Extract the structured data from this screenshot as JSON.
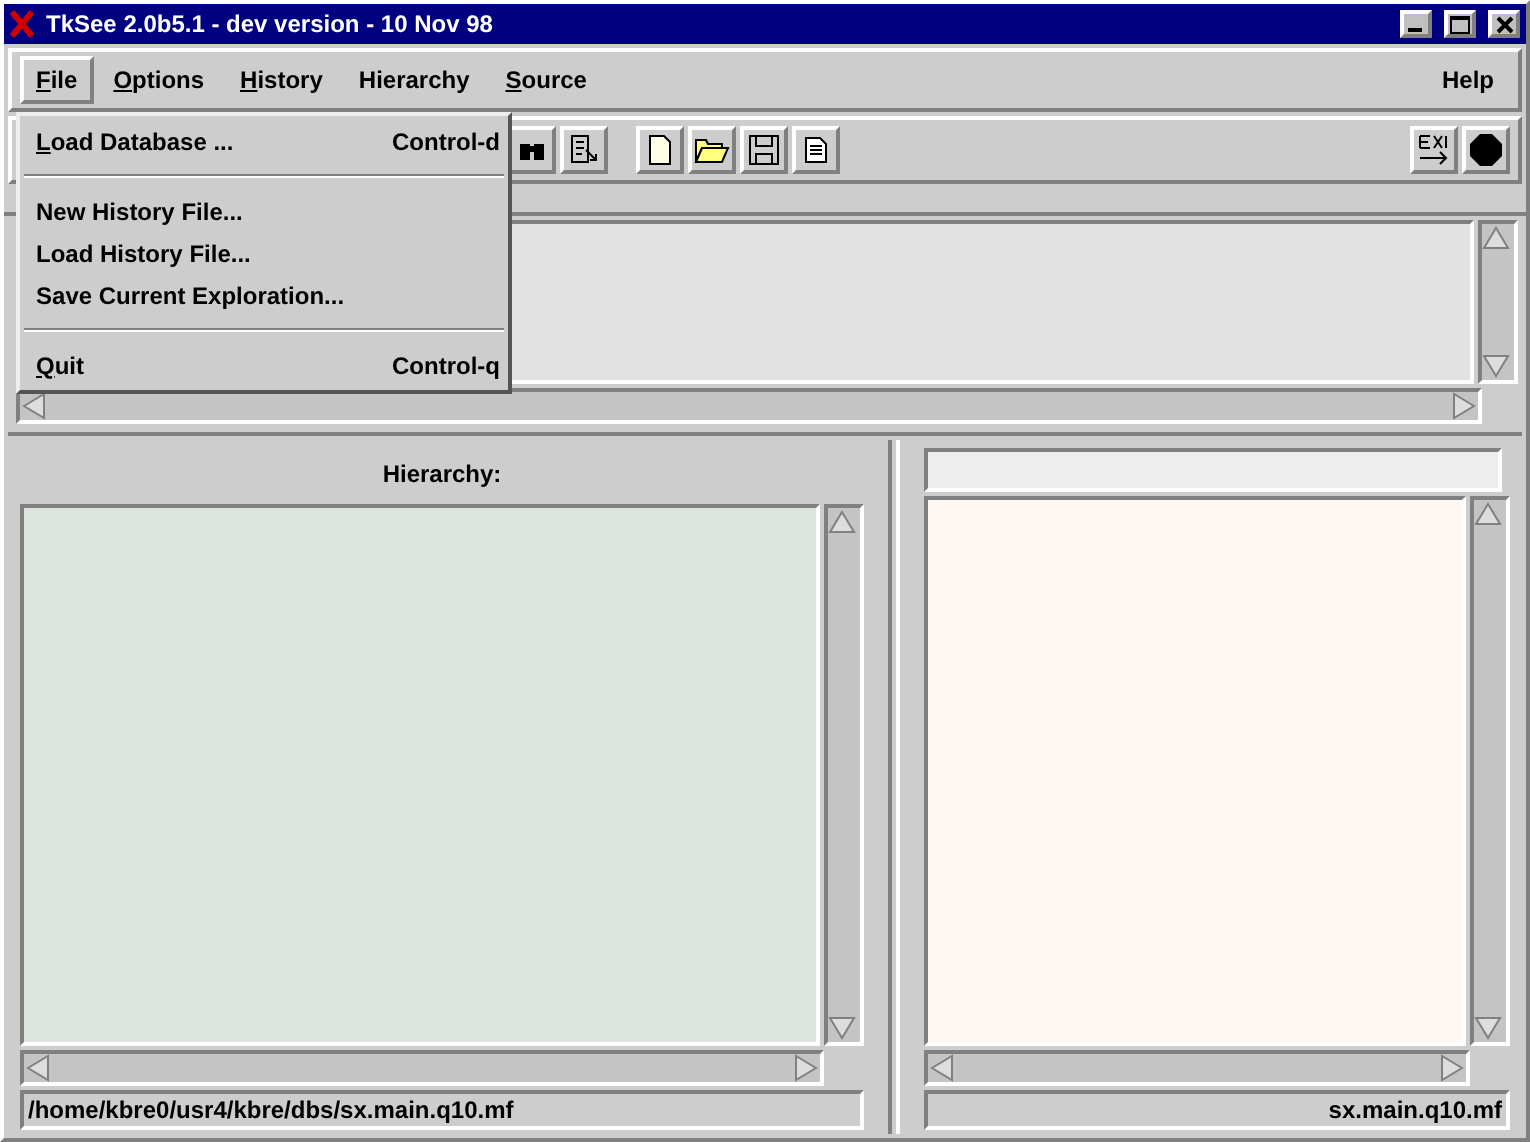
{
  "window": {
    "title": "TkSee 2.0b5.1 - dev version - 10 Nov 98"
  },
  "menubar": [
    {
      "label": "File",
      "underline_first": true,
      "selected": true
    },
    {
      "label": "Options",
      "underline_first": true,
      "selected": false
    },
    {
      "label": "History",
      "underline_first": true,
      "selected": false
    },
    {
      "label": "Hierarchy",
      "underline_first": false,
      "selected": false
    },
    {
      "label": "Source",
      "underline_first": true,
      "selected": false
    }
  ],
  "help": {
    "label": "Help"
  },
  "file_menu": [
    {
      "kind": "item",
      "label": "Load Database ...",
      "shortcut": "Control-d",
      "underline_first": true
    },
    {
      "kind": "separator"
    },
    {
      "kind": "item",
      "label": "New History File...",
      "underline_first": false
    },
    {
      "kind": "item",
      "label": "Load History File...",
      "underline_first": false
    },
    {
      "kind": "item",
      "label": "Save Current Exploration...",
      "underline_first": false
    },
    {
      "kind": "separator"
    },
    {
      "kind": "item",
      "label": "Quit",
      "shortcut": "Control-q",
      "underline_first": true
    }
  ],
  "hierarchy_pane": {
    "label": "Hierarchy:",
    "status": "/home/kbre0/usr4/kbre/dbs/sx.main.q10.mf"
  },
  "source_pane": {
    "status": "sx.main.q10.mf"
  }
}
